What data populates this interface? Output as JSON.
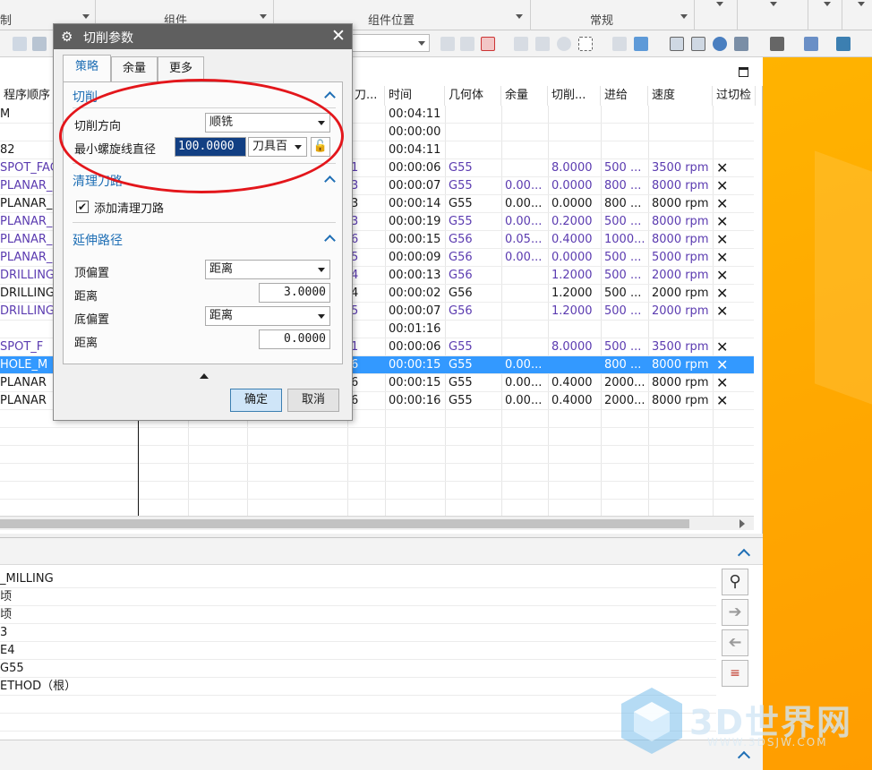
{
  "ribbon": {
    "groups": [
      "制",
      "组件",
      "组件位置",
      "常规"
    ]
  },
  "navigator": {
    "title_col": "程序顺序",
    "columns": {
      "tool": "刀...",
      "time": "时间",
      "geometry": "几何体",
      "stock": "余量",
      "cut_depth": "切削...",
      "feed": "进给",
      "speed": "速度",
      "gouge": "过切检"
    },
    "rows": [
      {
        "name": "M",
        "tool": "",
        "time": "00:04:11",
        "geometry": "",
        "stock": "",
        "cut": "",
        "feed": "",
        "speed": "",
        "gouge": "",
        "purple": false,
        "selected": false
      },
      {
        "name": "",
        "tool": "",
        "time": "00:00:00",
        "geometry": "",
        "stock": "",
        "cut": "",
        "feed": "",
        "speed": "",
        "gouge": "",
        "purple": false,
        "selected": false
      },
      {
        "name": "82",
        "tool": "",
        "time": "00:04:11",
        "geometry": "",
        "stock": "",
        "cut": "",
        "feed": "",
        "speed": "",
        "gouge": "",
        "purple": false,
        "selected": false
      },
      {
        "name": "SPOT_FAC",
        "tool": "1",
        "time": "00:00:06",
        "geometry": "G55",
        "stock": "",
        "cut": "8.0000",
        "feed": "500 ...",
        "speed": "3500 rpm",
        "gouge": "✕",
        "purple": true,
        "selected": false
      },
      {
        "name": "PLANAR_M",
        "tool": "3",
        "time": "00:00:07",
        "geometry": "G55",
        "stock": "0.00...",
        "cut": "0.0000",
        "feed": "800 ...",
        "speed": "8000 rpm",
        "gouge": "✕",
        "purple": true,
        "selected": false
      },
      {
        "name": "PLANAR_M",
        "tool": "3",
        "time": "00:00:14",
        "geometry": "G55",
        "stock": "0.00...",
        "cut": "0.0000",
        "feed": "800 ...",
        "speed": "8000 rpm",
        "gouge": "✕",
        "purple": false,
        "selected": false
      },
      {
        "name": "PLANAR_M",
        "tool": "3",
        "time": "00:00:19",
        "geometry": "G55",
        "stock": "0.00...",
        "cut": "0.2000",
        "feed": "500 ...",
        "speed": "8000 rpm",
        "gouge": "✕",
        "purple": true,
        "selected": false
      },
      {
        "name": "PLANAR_M",
        "tool": "6",
        "time": "00:00:15",
        "geometry": "G56",
        "stock": "0.05...",
        "cut": "0.4000",
        "feed": "1000...",
        "speed": "8000 rpm",
        "gouge": "✕",
        "purple": true,
        "selected": false
      },
      {
        "name": "PLANAR_M",
        "tool": "5",
        "time": "00:00:09",
        "geometry": "G56",
        "stock": "0.00...",
        "cut": "0.0000",
        "feed": "500 ...",
        "speed": "5000 rpm",
        "gouge": "✕",
        "purple": true,
        "selected": false
      },
      {
        "name": "DRILLING",
        "tool": "4",
        "time": "00:00:13",
        "geometry": "G56",
        "stock": "",
        "cut": "1.2000",
        "feed": "500 ...",
        "speed": "2000 rpm",
        "gouge": "✕",
        "purple": true,
        "selected": false
      },
      {
        "name": "DRILLING_",
        "tool": "4",
        "time": "00:00:02",
        "geometry": "G56",
        "stock": "",
        "cut": "1.2000",
        "feed": "500 ...",
        "speed": "2000 rpm",
        "gouge": "✕",
        "purple": false,
        "selected": false
      },
      {
        "name": "DRILLING_",
        "tool": "5",
        "time": "00:00:07",
        "geometry": "G56",
        "stock": "",
        "cut": "1.2000",
        "feed": "500 ...",
        "speed": "2000 rpm",
        "gouge": "✕",
        "purple": true,
        "selected": false
      },
      {
        "name": "",
        "tool": "",
        "time": "00:01:16",
        "geometry": "",
        "stock": "",
        "cut": "",
        "feed": "",
        "speed": "",
        "gouge": "",
        "purple": false,
        "selected": false
      },
      {
        "name": "SPOT_F",
        "tool": "1",
        "time": "00:00:06",
        "geometry": "G55",
        "stock": "",
        "cut": "8.0000",
        "feed": "500 ...",
        "speed": "3500 rpm",
        "gouge": "✕",
        "purple": true,
        "selected": false
      },
      {
        "name": "HOLE_M",
        "tool": "6",
        "time": "00:00:15",
        "geometry": "G55",
        "stock": "0.00...",
        "cut": "",
        "feed": "800 ...",
        "speed": "8000 rpm",
        "gouge": "✕",
        "purple": false,
        "selected": true
      },
      {
        "name": "PLANAR",
        "tool": "6",
        "time": "00:00:15",
        "geometry": "G55",
        "stock": "0.00...",
        "cut": "0.4000",
        "feed": "2000...",
        "speed": "8000 rpm",
        "gouge": "✕",
        "purple": false,
        "selected": false
      },
      {
        "name": "PLANAR",
        "tool": "6",
        "time": "00:00:16",
        "geometry": "G55",
        "stock": "0.00...",
        "cut": "0.4000",
        "feed": "2000...",
        "speed": "8000 rpm",
        "gouge": "✕",
        "purple": false,
        "selected": false
      }
    ]
  },
  "details": {
    "rows": [
      "_MILLING",
      "顷",
      "顷",
      "3",
      "E4",
      "G55",
      "ETHOD（根）"
    ]
  },
  "dialog": {
    "title": "切削参数",
    "tabs": [
      "策略",
      "余量",
      "更多"
    ],
    "active_tab": "策略",
    "section_cut": "切削",
    "cut_direction_label": "切削方向",
    "cut_direction_value": "顺铣",
    "helix_label": "最小螺旋线直径",
    "helix_value": "100.0000",
    "helix_unit": "刀具百",
    "section_cleanup": "清理刀路",
    "add_cleanup_label": "添加清理刀路",
    "add_cleanup_checked": "✔",
    "section_extend": "延伸路径",
    "top_offset_label": "顶偏置",
    "top_offset_mode": "距离",
    "top_distance_label": "距离",
    "top_distance_value": "3.0000",
    "bottom_offset_label": "底偏置",
    "bottom_offset_mode": "距离",
    "bottom_distance_label": "距离",
    "bottom_distance_value": "0.0000",
    "ok": "确定",
    "cancel": "取消"
  },
  "watermark": {
    "text": "3D世界网",
    "url": "WWW.3DSJW.COM"
  },
  "colors": {
    "accent": "#1f6fb5",
    "selection": "#3399ff",
    "purple_text": "#5b3bb0",
    "annotation_red": "#e3161b",
    "side_orange": "#ffb300"
  }
}
